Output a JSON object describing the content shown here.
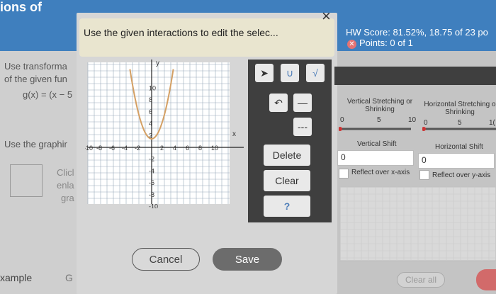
{
  "background": {
    "title_fragment": "ions of",
    "left_text": [
      "Use transforma",
      "of the given fun",
      "g(x) = (x − 5",
      "Use the graphir",
      "Clicl",
      "enla",
      "gra"
    ],
    "bottom_left": "xample",
    "bottom_left2": "G"
  },
  "hw": {
    "score": "HW Score: 81.52%, 18.75 of 23 po",
    "points": "Points: 0 of 1"
  },
  "modal": {
    "prompt": "Use the given interactions to edit the selec...",
    "close": "×",
    "cancel": "Cancel",
    "save": "Save",
    "side_buttons": {
      "delete": "Delete",
      "clear": "Clear",
      "help": "?"
    }
  },
  "graph": {
    "y_axis_label": "y",
    "x_axis_label": "x",
    "x_ticks": [
      "-10",
      "-8",
      "-6",
      "-4",
      "-2",
      "2",
      "4",
      "6",
      "8",
      "10"
    ],
    "y_ticks": [
      "10",
      "8",
      "6",
      "4",
      "2",
      "-2",
      "-4",
      "-6",
      "-8",
      "-10"
    ],
    "curve_color": "#d4a064"
  },
  "toolbar": {
    "tools": [
      "pointer-icon",
      "parabola-icon",
      "sqrt-curve-icon",
      "undo-icon",
      "solid-line-icon",
      "dashed-line-icon"
    ]
  },
  "transform_panel": {
    "vertical_stretch_label": "Vertical Stretching or Shrinking",
    "vertical_stretch_ticks": [
      "0",
      "5",
      "10"
    ],
    "horizontal_stretch_label": "Horizontal Stretching o Shrinking",
    "horizontal_stretch_ticks": [
      "0",
      "5",
      "1("
    ],
    "vertical_shift_label": "Vertical Shift",
    "vertical_shift_value": "0",
    "horizontal_shift_label": "Horizontal Shift",
    "horizontal_shift_value": "0",
    "reflect_x": "Reflect over x-axis",
    "reflect_y": "Reflect over y-axis",
    "clear_all": "Clear all"
  }
}
